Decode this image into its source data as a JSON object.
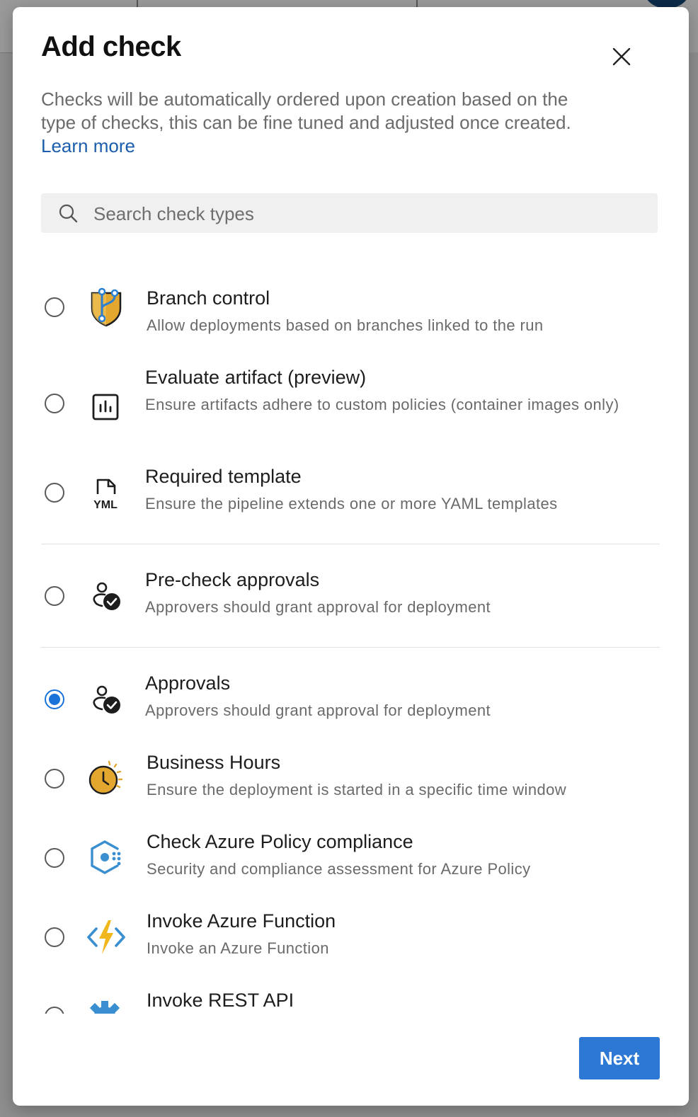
{
  "dialog": {
    "title": "Add check",
    "description": "Checks will be automatically ordered upon creation based on the type of checks, this can be fine tuned and adjusted once created.",
    "learn_more": "Learn more",
    "search_placeholder": "Search check types",
    "next_label": "Next"
  },
  "checks": [
    {
      "title": "Branch control",
      "description": "Allow deployments based on branches linked to the run",
      "icon": "branch-shield-icon",
      "selected": false
    },
    {
      "title": "Evaluate artifact (preview)",
      "description": "Ensure artifacts adhere to custom policies (container images only)",
      "icon": "chart-box-icon",
      "selected": false
    },
    {
      "title": "Required template",
      "description": "Ensure the pipeline extends one or more YAML templates",
      "icon": "yml-file-icon",
      "selected": false
    },
    {
      "title": "Pre-check approvals",
      "description": "Approvers should grant approval for deployment",
      "icon": "person-check-icon",
      "selected": false
    },
    {
      "title": "Approvals",
      "description": "Approvers should grant approval for deployment",
      "icon": "person-check-icon",
      "selected": true
    },
    {
      "title": "Business Hours",
      "description": "Ensure the deployment is started in a specific time window",
      "icon": "clock-sun-icon",
      "selected": false
    },
    {
      "title": "Check Azure Policy compliance",
      "description": "Security and compliance assessment for Azure Policy",
      "icon": "azure-policy-icon",
      "selected": false
    },
    {
      "title": "Invoke Azure Function",
      "description": "Invoke an Azure Function",
      "icon": "azure-function-icon",
      "selected": false
    },
    {
      "title": "Invoke REST API",
      "description": "",
      "icon": "gear-icon",
      "selected": false
    }
  ],
  "colors": {
    "accent": "#2c78d4",
    "link": "#1b5eac",
    "branch_shield": "#e3a72f",
    "clock": "#e3a72f",
    "azure_blue": "#3a8fd1"
  }
}
